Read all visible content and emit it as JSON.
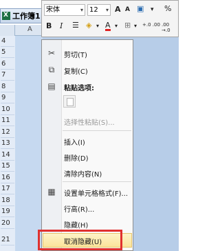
{
  "workbook": {
    "title_tab": "工作簿1",
    "column_label": "A"
  },
  "rows": [
    "4",
    "5",
    "6",
    "7",
    "8",
    "9",
    "10",
    "11",
    "12",
    "13",
    "14",
    "15",
    "16",
    "17",
    "18",
    "19",
    "20",
    "21"
  ],
  "mini_toolbar": {
    "font_name": "宋体",
    "font_size": "12",
    "grow_font": "A",
    "shrink_font": "A",
    "percent": "%",
    "bold": "B",
    "italic": "I",
    "font_color": "A",
    "decimal_increase": "+.0 .00",
    "decimal_decrease": ".00 →.0"
  },
  "context_menu": {
    "items": [
      {
        "label": "剪切(T)",
        "icon": "scissors-icon"
      },
      {
        "label": "复制(C)",
        "icon": "copy-icon"
      },
      {
        "label": "粘贴选项:",
        "icon": "paste-icon"
      },
      {
        "label": "选择性粘贴(S)...",
        "icon": ""
      },
      {
        "label": "插入(I)",
        "icon": ""
      },
      {
        "label": "删除(D)",
        "icon": ""
      },
      {
        "label": "清除内容(N)",
        "icon": ""
      },
      {
        "label": "设置单元格格式(F)...",
        "icon": "format-cells-icon"
      },
      {
        "label": "行高(R)...",
        "icon": ""
      },
      {
        "label": "隐藏(H)",
        "icon": ""
      },
      {
        "label": "取消隐藏(U)",
        "icon": ""
      }
    ],
    "highlight_color": "#fbe49a",
    "callout_color": "#e0312f"
  }
}
